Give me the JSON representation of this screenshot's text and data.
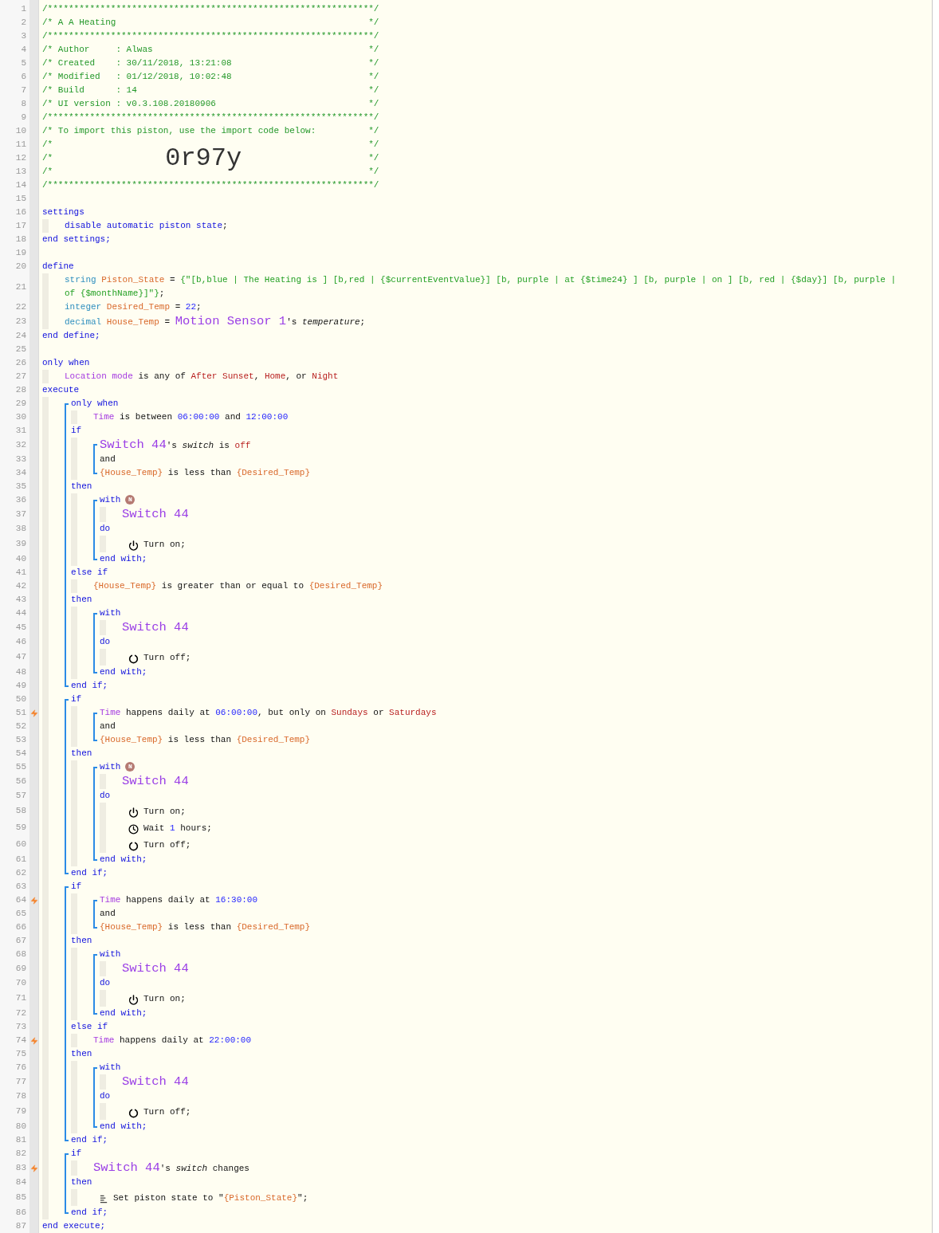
{
  "editor": {
    "lines": [
      {
        "kind": "comment",
        "n": "1",
        "trigger": false,
        "text": "/**************************************************************/"
      },
      {
        "kind": "comment",
        "n": "2",
        "trigger": false,
        "text": "/* A A Heating",
        "end": "*/"
      },
      {
        "kind": "comment",
        "n": "3",
        "trigger": false,
        "text": "/**************************************************************/"
      },
      {
        "kind": "comment",
        "n": "4",
        "trigger": false,
        "text": "/* Author     : Alwas",
        "end": "*/"
      },
      {
        "kind": "comment",
        "n": "5",
        "trigger": false,
        "text": "/* Created    : 30/11/2018, 13:21:08",
        "end": "*/"
      },
      {
        "kind": "comment",
        "n": "6",
        "trigger": false,
        "text": "/* Modified   : 01/12/2018, 10:02:48",
        "end": "*/"
      },
      {
        "kind": "comment",
        "n": "7",
        "trigger": false,
        "text": "/* Build      : 14",
        "end": "*/"
      },
      {
        "kind": "comment",
        "n": "8",
        "trigger": false,
        "text": "/* UI version : v0.3.108.20180906",
        "end": "*/"
      },
      {
        "kind": "comment",
        "n": "9",
        "trigger": false,
        "text": "/**************************************************************/"
      },
      {
        "kind": "comment",
        "n": "10",
        "trigger": false,
        "text": "/* To import this piston, use the import code below:",
        "end": "*/"
      },
      {
        "kind": "comment",
        "n": "11",
        "trigger": false,
        "text": "/*",
        "end": "*/"
      },
      {
        "kind": "comment",
        "n": "12",
        "trigger": false,
        "text": "/*",
        "code": "0r97y",
        "end": "*/"
      },
      {
        "kind": "comment",
        "n": "13",
        "trigger": false,
        "text": "/*",
        "end": "*/"
      },
      {
        "kind": "comment",
        "n": "14",
        "trigger": false,
        "text": "/**************************************************************/"
      },
      {
        "kind": "line",
        "n": "15",
        "trigger": false
      },
      {
        "kind": "line",
        "n": "16",
        "trigger": false,
        "segs": [
          {
            "kind": "kw",
            "text": "settings"
          }
        ]
      },
      {
        "kind": "guide_block",
        "children": [
          {
            "kind": "line",
            "n": "17",
            "trigger": false,
            "segs": [
              {
                "kind": "kw",
                "text": "disable automatic piston state"
              },
              {
                "kind": "txt",
                "text": ";"
              }
            ]
          }
        ]
      },
      {
        "kind": "line",
        "n": "18",
        "trigger": false,
        "segs": [
          {
            "kind": "kw",
            "text": "end settings;"
          }
        ]
      },
      {
        "kind": "line",
        "n": "19",
        "trigger": false
      },
      {
        "kind": "line",
        "n": "20",
        "trigger": false,
        "segs": [
          {
            "kind": "kw",
            "text": "define"
          }
        ]
      },
      {
        "kind": "guide_block",
        "children": [
          {
            "kind": "line",
            "n": "21",
            "trigger": false,
            "segs": [
              {
                "kind": "type",
                "text": "string "
              },
              {
                "kind": "var",
                "text": "Piston_State"
              },
              {
                "kind": "txt",
                "text": " = "
              },
              {
                "kind": "str",
                "text": "{\"[b,blue | The Heating is ] [b,red | {$currentEventValue}] [b, purple | at {$time24} ] [b, purple | on ] [b, red | {$day}] [b, purple |"
              },
              {
                "kind": "str",
                "text": "of {$monthName}]\"}"
              },
              {
                "kind": "txt",
                "text": ";"
              }
            ]
          },
          {
            "kind": "line",
            "n": "22",
            "trigger": false,
            "segs": [
              {
                "kind": "type",
                "text": "integer "
              },
              {
                "kind": "var",
                "text": "Desired_Temp"
              },
              {
                "kind": "txt",
                "text": " = "
              },
              {
                "kind": "val",
                "text": "22"
              },
              {
                "kind": "txt",
                "text": ";"
              }
            ]
          },
          {
            "kind": "line",
            "n": "23",
            "trigger": false,
            "segs": [
              {
                "kind": "type",
                "text": "decimal "
              },
              {
                "kind": "var",
                "text": "House_Temp"
              },
              {
                "kind": "txt",
                "text": " = "
              },
              {
                "kind": "dev",
                "text": "Motion Sensor 1"
              },
              {
                "kind": "txt",
                "text": "'s "
              },
              {
                "kind": "ital",
                "text": "temperature"
              },
              {
                "kind": "txt",
                "text": ";"
              }
            ]
          }
        ]
      },
      {
        "kind": "line",
        "n": "24",
        "trigger": false,
        "segs": [
          {
            "kind": "kw",
            "text": "end define;"
          }
        ]
      },
      {
        "kind": "line",
        "n": "25",
        "trigger": false
      },
      {
        "kind": "line",
        "n": "26",
        "trigger": false,
        "segs": [
          {
            "kind": "kw",
            "text": "only when"
          }
        ]
      },
      {
        "kind": "guide_block",
        "children": [
          {
            "kind": "line",
            "n": "27",
            "trigger": false,
            "segs": [
              {
                "kind": "subj",
                "text": "Location mode"
              },
              {
                "kind": "txt",
                "text": " is any of "
              },
              {
                "kind": "const",
                "text": "After Sunset"
              },
              {
                "kind": "txt",
                "text": ", "
              },
              {
                "kind": "const",
                "text": "Home"
              },
              {
                "kind": "txt",
                "text": ", or "
              },
              {
                "kind": "const",
                "text": "Night"
              }
            ]
          }
        ]
      },
      {
        "kind": "line",
        "n": "28",
        "trigger": false,
        "segs": [
          {
            "kind": "kw",
            "text": "execute"
          }
        ]
      },
      {
        "kind": "guide_block",
        "children": [
          {
            "kind": "bracket_block",
            "children": [
              {
                "kind": "line",
                "n": "29",
                "trigger": false,
                "segs": [
                  {
                    "kind": "kw",
                    "text": "only when"
                  }
                ]
              },
              {
                "kind": "guide_block",
                "children": [
                  {
                    "kind": "line",
                    "n": "30",
                    "trigger": false,
                    "segs": [
                      {
                        "kind": "subj",
                        "text": "Time"
                      },
                      {
                        "kind": "txt",
                        "text": " is between "
                      },
                      {
                        "kind": "val",
                        "text": "06:00:00"
                      },
                      {
                        "kind": "txt",
                        "text": " and "
                      },
                      {
                        "kind": "val",
                        "text": "12:00:00"
                      }
                    ]
                  }
                ]
              },
              {
                "kind": "line",
                "n": "31",
                "trigger": false,
                "segs": [
                  {
                    "kind": "kw",
                    "text": "if"
                  }
                ]
              },
              {
                "kind": "guide_block",
                "children": [
                  {
                    "kind": "bracket_block",
                    "children": [
                      {
                        "kind": "line",
                        "n": "32",
                        "trigger": false,
                        "segs": [
                          {
                            "kind": "dev",
                            "text": "Switch 44"
                          },
                          {
                            "kind": "txt",
                            "text": "'s "
                          },
                          {
                            "kind": "ital",
                            "text": "switch"
                          },
                          {
                            "kind": "txt",
                            "text": " is "
                          },
                          {
                            "kind": "const",
                            "text": "off"
                          }
                        ]
                      },
                      {
                        "kind": "line",
                        "n": "33",
                        "trigger": false,
                        "segs": [
                          {
                            "kind": "txt",
                            "text": "and"
                          }
                        ]
                      },
                      {
                        "kind": "line",
                        "n": "34",
                        "trigger": false,
                        "segs": [
                          {
                            "kind": "var",
                            "text": "{House_Temp}"
                          },
                          {
                            "kind": "txt",
                            "text": " is less than "
                          },
                          {
                            "kind": "var",
                            "text": "{Desired_Temp}"
                          }
                        ]
                      }
                    ]
                  }
                ]
              },
              {
                "kind": "line",
                "n": "35",
                "trigger": false,
                "segs": [
                  {
                    "kind": "kw",
                    "text": "then"
                  }
                ]
              },
              {
                "kind": "guide_block",
                "children": [
                  {
                    "kind": "bracket_block",
                    "children": [
                      {
                        "kind": "line",
                        "n": "36",
                        "trigger": false,
                        "segs": [
                          {
                            "kind": "kw",
                            "text": "with"
                          },
                          {
                            "kind": "badge",
                            "text": "N"
                          }
                        ]
                      },
                      {
                        "kind": "guide_block",
                        "children": [
                          {
                            "kind": "line",
                            "n": "37",
                            "trigger": false,
                            "segs": [
                              {
                                "kind": "dev",
                                "text": "Switch 44"
                              }
                            ]
                          }
                        ]
                      },
                      {
                        "kind": "line",
                        "n": "38",
                        "trigger": false,
                        "segs": [
                          {
                            "kind": "kw",
                            "text": "do"
                          }
                        ]
                      },
                      {
                        "kind": "guide_block",
                        "children": [
                          {
                            "kind": "power_action",
                            "n": "39",
                            "trigger": false,
                            "segs": [
                              {
                                "kind": "txt",
                                "text": "Turn on;"
                              }
                            ]
                          }
                        ]
                      },
                      {
                        "kind": "line",
                        "n": "40",
                        "trigger": false,
                        "segs": [
                          {
                            "kind": "kw",
                            "text": "end with;"
                          }
                        ]
                      }
                    ]
                  }
                ]
              },
              {
                "kind": "line",
                "n": "41",
                "trigger": false,
                "segs": [
                  {
                    "kind": "kw",
                    "text": "else if"
                  }
                ]
              },
              {
                "kind": "guide_block",
                "children": [
                  {
                    "kind": "line",
                    "n": "42",
                    "trigger": false,
                    "segs": [
                      {
                        "kind": "var",
                        "text": "{House_Temp}"
                      },
                      {
                        "kind": "txt",
                        "text": " is greater than or equal to "
                      },
                      {
                        "kind": "var",
                        "text": "{Desired_Temp}"
                      }
                    ]
                  }
                ]
              },
              {
                "kind": "line",
                "n": "43",
                "trigger": false,
                "segs": [
                  {
                    "kind": "kw",
                    "text": "then"
                  }
                ]
              },
              {
                "kind": "guide_block",
                "children": [
                  {
                    "kind": "bracket_block",
                    "children": [
                      {
                        "kind": "line",
                        "n": "44",
                        "trigger": false,
                        "segs": [
                          {
                            "kind": "kw",
                            "text": "with"
                          }
                        ]
                      },
                      {
                        "kind": "guide_block",
                        "children": [
                          {
                            "kind": "line",
                            "n": "45",
                            "trigger": false,
                            "segs": [
                              {
                                "kind": "dev",
                                "text": "Switch 44"
                              }
                            ]
                          }
                        ]
                      },
                      {
                        "kind": "line",
                        "n": "46",
                        "trigger": false,
                        "segs": [
                          {
                            "kind": "kw",
                            "text": "do"
                          }
                        ]
                      },
                      {
                        "kind": "guide_block",
                        "children": [
                          {
                            "kind": "off_action",
                            "n": "47",
                            "trigger": false,
                            "segs": [
                              {
                                "kind": "txt",
                                "text": "Turn off;"
                              }
                            ]
                          }
                        ]
                      },
                      {
                        "kind": "line",
                        "n": "48",
                        "trigger": false,
                        "segs": [
                          {
                            "kind": "kw",
                            "text": "end with;"
                          }
                        ]
                      }
                    ]
                  }
                ]
              },
              {
                "kind": "line",
                "n": "49",
                "trigger": false,
                "segs": [
                  {
                    "kind": "kw",
                    "text": "end if;"
                  }
                ]
              }
            ]
          },
          {
            "kind": "bracket_block",
            "children": [
              {
                "kind": "line",
                "n": "50",
                "trigger": false,
                "segs": [
                  {
                    "kind": "kw",
                    "text": "if"
                  }
                ]
              },
              {
                "kind": "guide_block",
                "children": [
                  {
                    "kind": "bracket_block",
                    "children": [
                      {
                        "kind": "line",
                        "n": "51",
                        "trigger": true,
                        "segs": [
                          {
                            "kind": "subj",
                            "text": "Time"
                          },
                          {
                            "kind": "txt",
                            "text": " happens daily at "
                          },
                          {
                            "kind": "val",
                            "text": "06:00:00"
                          },
                          {
                            "kind": "txt",
                            "text": ", but only on "
                          },
                          {
                            "kind": "const",
                            "text": "Sundays"
                          },
                          {
                            "kind": "txt",
                            "text": " or "
                          },
                          {
                            "kind": "const",
                            "text": "Saturdays"
                          }
                        ]
                      },
                      {
                        "kind": "line",
                        "n": "52",
                        "trigger": false,
                        "segs": [
                          {
                            "kind": "txt",
                            "text": "and"
                          }
                        ]
                      },
                      {
                        "kind": "line",
                        "n": "53",
                        "trigger": false,
                        "segs": [
                          {
                            "kind": "var",
                            "text": "{House_Temp}"
                          },
                          {
                            "kind": "txt",
                            "text": " is less than "
                          },
                          {
                            "kind": "var",
                            "text": "{Desired_Temp}"
                          }
                        ]
                      }
                    ]
                  }
                ]
              },
              {
                "kind": "line",
                "n": "54",
                "trigger": false,
                "segs": [
                  {
                    "kind": "kw",
                    "text": "then"
                  }
                ]
              },
              {
                "kind": "guide_block",
                "children": [
                  {
                    "kind": "bracket_block",
                    "children": [
                      {
                        "kind": "line",
                        "n": "55",
                        "trigger": false,
                        "segs": [
                          {
                            "kind": "kw",
                            "text": "with"
                          },
                          {
                            "kind": "badge",
                            "text": "N"
                          }
                        ]
                      },
                      {
                        "kind": "guide_block",
                        "children": [
                          {
                            "kind": "line",
                            "n": "56",
                            "trigger": false,
                            "segs": [
                              {
                                "kind": "dev",
                                "text": "Switch 44"
                              }
                            ]
                          }
                        ]
                      },
                      {
                        "kind": "line",
                        "n": "57",
                        "trigger": false,
                        "segs": [
                          {
                            "kind": "kw",
                            "text": "do"
                          }
                        ]
                      },
                      {
                        "kind": "guide_block",
                        "children": [
                          {
                            "kind": "power_action",
                            "n": "58",
                            "trigger": false,
                            "segs": [
                              {
                                "kind": "txt",
                                "text": "Turn on;"
                              }
                            ]
                          },
                          {
                            "kind": "wait_action",
                            "n": "59",
                            "trigger": false,
                            "segs": [
                              {
                                "kind": "txt",
                                "text": "Wait "
                              },
                              {
                                "kind": "val",
                                "text": "1"
                              },
                              {
                                "kind": "txt",
                                "text": " hours;"
                              }
                            ]
                          },
                          {
                            "kind": "off_action",
                            "n": "60",
                            "trigger": false,
                            "segs": [
                              {
                                "kind": "txt",
                                "text": "Turn off;"
                              }
                            ]
                          }
                        ]
                      },
                      {
                        "kind": "line",
                        "n": "61",
                        "trigger": false,
                        "segs": [
                          {
                            "kind": "kw",
                            "text": "end with;"
                          }
                        ]
                      }
                    ]
                  }
                ]
              },
              {
                "kind": "line",
                "n": "62",
                "trigger": false,
                "segs": [
                  {
                    "kind": "kw",
                    "text": "end if;"
                  }
                ]
              }
            ]
          },
          {
            "kind": "bracket_block",
            "children": [
              {
                "kind": "line",
                "n": "63",
                "trigger": false,
                "segs": [
                  {
                    "kind": "kw",
                    "text": "if"
                  }
                ]
              },
              {
                "kind": "guide_block",
                "children": [
                  {
                    "kind": "bracket_block",
                    "children": [
                      {
                        "kind": "line",
                        "n": "64",
                        "trigger": true,
                        "segs": [
                          {
                            "kind": "subj",
                            "text": "Time"
                          },
                          {
                            "kind": "txt",
                            "text": " happens daily at "
                          },
                          {
                            "kind": "val",
                            "text": "16:30:00"
                          }
                        ]
                      },
                      {
                        "kind": "line",
                        "n": "65",
                        "trigger": false,
                        "segs": [
                          {
                            "kind": "txt",
                            "text": "and"
                          }
                        ]
                      },
                      {
                        "kind": "line",
                        "n": "66",
                        "trigger": false,
                        "segs": [
                          {
                            "kind": "var",
                            "text": "{House_Temp}"
                          },
                          {
                            "kind": "txt",
                            "text": " is less than "
                          },
                          {
                            "kind": "var",
                            "text": "{Desired_Temp}"
                          }
                        ]
                      }
                    ]
                  }
                ]
              },
              {
                "kind": "line",
                "n": "67",
                "trigger": false,
                "segs": [
                  {
                    "kind": "kw",
                    "text": "then"
                  }
                ]
              },
              {
                "kind": "guide_block",
                "children": [
                  {
                    "kind": "bracket_block",
                    "children": [
                      {
                        "kind": "line",
                        "n": "68",
                        "trigger": false,
                        "segs": [
                          {
                            "kind": "kw",
                            "text": "with"
                          }
                        ]
                      },
                      {
                        "kind": "guide_block",
                        "children": [
                          {
                            "kind": "line",
                            "n": "69",
                            "trigger": false,
                            "segs": [
                              {
                                "kind": "dev",
                                "text": "Switch 44"
                              }
                            ]
                          }
                        ]
                      },
                      {
                        "kind": "line",
                        "n": "70",
                        "trigger": false,
                        "segs": [
                          {
                            "kind": "kw",
                            "text": "do"
                          }
                        ]
                      },
                      {
                        "kind": "guide_block",
                        "children": [
                          {
                            "kind": "power_action",
                            "n": "71",
                            "trigger": false,
                            "segs": [
                              {
                                "kind": "txt",
                                "text": "Turn on;"
                              }
                            ]
                          }
                        ]
                      },
                      {
                        "kind": "line",
                        "n": "72",
                        "trigger": false,
                        "segs": [
                          {
                            "kind": "kw",
                            "text": "end with;"
                          }
                        ]
                      }
                    ]
                  }
                ]
              },
              {
                "kind": "line",
                "n": "73",
                "trigger": false,
                "segs": [
                  {
                    "kind": "kw",
                    "text": "else if"
                  }
                ]
              },
              {
                "kind": "guide_block",
                "children": [
                  {
                    "kind": "line",
                    "n": "74",
                    "trigger": true,
                    "segs": [
                      {
                        "kind": "subj",
                        "text": "Time"
                      },
                      {
                        "kind": "txt",
                        "text": " happens daily at "
                      },
                      {
                        "kind": "val",
                        "text": "22:00:00"
                      }
                    ]
                  }
                ]
              },
              {
                "kind": "line",
                "n": "75",
                "trigger": false,
                "segs": [
                  {
                    "kind": "kw",
                    "text": "then"
                  }
                ]
              },
              {
                "kind": "guide_block",
                "children": [
                  {
                    "kind": "bracket_block",
                    "children": [
                      {
                        "kind": "line",
                        "n": "76",
                        "trigger": false,
                        "segs": [
                          {
                            "kind": "kw",
                            "text": "with"
                          }
                        ]
                      },
                      {
                        "kind": "guide_block",
                        "children": [
                          {
                            "kind": "line",
                            "n": "77",
                            "trigger": false,
                            "segs": [
                              {
                                "kind": "dev",
                                "text": "Switch 44"
                              }
                            ]
                          }
                        ]
                      },
                      {
                        "kind": "line",
                        "n": "78",
                        "trigger": false,
                        "segs": [
                          {
                            "kind": "kw",
                            "text": "do"
                          }
                        ]
                      },
                      {
                        "kind": "guide_block",
                        "children": [
                          {
                            "kind": "off_action",
                            "n": "79",
                            "trigger": false,
                            "segs": [
                              {
                                "kind": "txt",
                                "text": "Turn off;"
                              }
                            ]
                          }
                        ]
                      },
                      {
                        "kind": "line",
                        "n": "80",
                        "trigger": false,
                        "segs": [
                          {
                            "kind": "kw",
                            "text": "end with;"
                          }
                        ]
                      }
                    ]
                  }
                ]
              },
              {
                "kind": "line",
                "n": "81",
                "trigger": false,
                "segs": [
                  {
                    "kind": "kw",
                    "text": "end if;"
                  }
                ]
              }
            ]
          },
          {
            "kind": "bracket_block",
            "children": [
              {
                "kind": "line",
                "n": "82",
                "trigger": false,
                "segs": [
                  {
                    "kind": "kw",
                    "text": "if"
                  }
                ]
              },
              {
                "kind": "guide_block",
                "children": [
                  {
                    "kind": "line",
                    "n": "83",
                    "trigger": true,
                    "segs": [
                      {
                        "kind": "dev",
                        "text": "Switch 44"
                      },
                      {
                        "kind": "txt",
                        "text": "'s "
                      },
                      {
                        "kind": "ital",
                        "text": "switch"
                      },
                      {
                        "kind": "txt",
                        "text": " changes"
                      }
                    ]
                  }
                ]
              },
              {
                "kind": "line",
                "n": "84",
                "trigger": false,
                "segs": [
                  {
                    "kind": "kw",
                    "text": "then"
                  }
                ]
              },
              {
                "kind": "guide_block",
                "children": [
                  {
                    "kind": "state_action",
                    "n": "85",
                    "trigger": false,
                    "segs": [
                      {
                        "kind": "txt",
                        "text": "Set piston state to \""
                      },
                      {
                        "kind": "var",
                        "text": "{Piston_State}"
                      },
                      {
                        "kind": "txt",
                        "text": "\";"
                      }
                    ]
                  }
                ]
              },
              {
                "kind": "line",
                "n": "86",
                "trigger": false,
                "segs": [
                  {
                    "kind": "kw",
                    "text": "end if;"
                  }
                ]
              }
            ]
          }
        ]
      },
      {
        "kind": "line",
        "n": "87",
        "trigger": false,
        "segs": [
          {
            "kind": "kw",
            "text": "end execute;"
          }
        ]
      }
    ]
  }
}
